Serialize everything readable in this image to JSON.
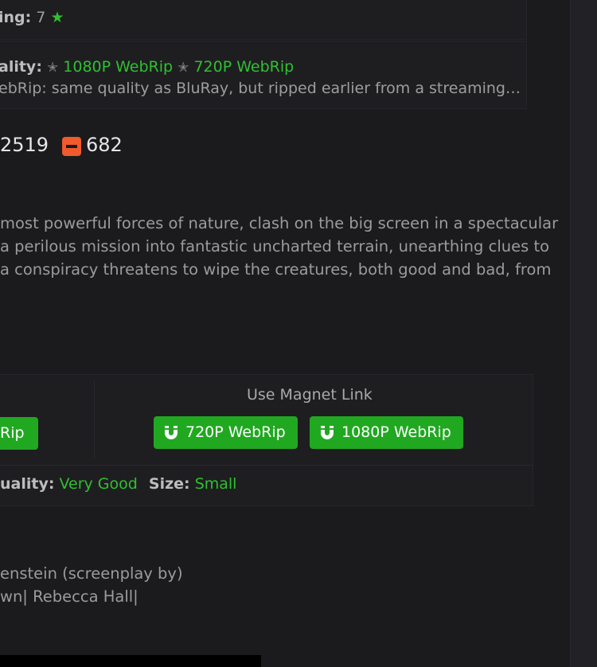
{
  "rating": {
    "label": "ing:",
    "value": "7",
    "icon": "star-icon"
  },
  "quality": {
    "label": "ality:",
    "option_1": "1080P WebRip",
    "option_2": "720P WebRip",
    "description": "ebRip: same quality as BluRay, but ripped earlier from a streaming…"
  },
  "votes": {
    "up_count": "2519",
    "down_count": "682",
    "down_color": "#f05a2c"
  },
  "synopsis": {
    "lines": [
      "most powerful forces of nature, clash on the big screen in a spectacular",
      "a perilous mission into fantastic uncharted terrain, unearthing clues to",
      " a conspiracy threatens to wipe the creatures, both good and bad, from"
    ]
  },
  "downloads": {
    "partial_button": "Rip",
    "magnet_title": "Use Magnet Link",
    "magnet_720": "720P WebRip",
    "magnet_1080": "1080P WebRip",
    "quality_label": "uality:",
    "quality_value": "Very Good",
    "size_label": "Size:",
    "size_value": "Small",
    "accent": "#21a821"
  },
  "credits": {
    "writer": "enstein (screenplay by)",
    "cast": "wn| Rebecca Hall|"
  }
}
